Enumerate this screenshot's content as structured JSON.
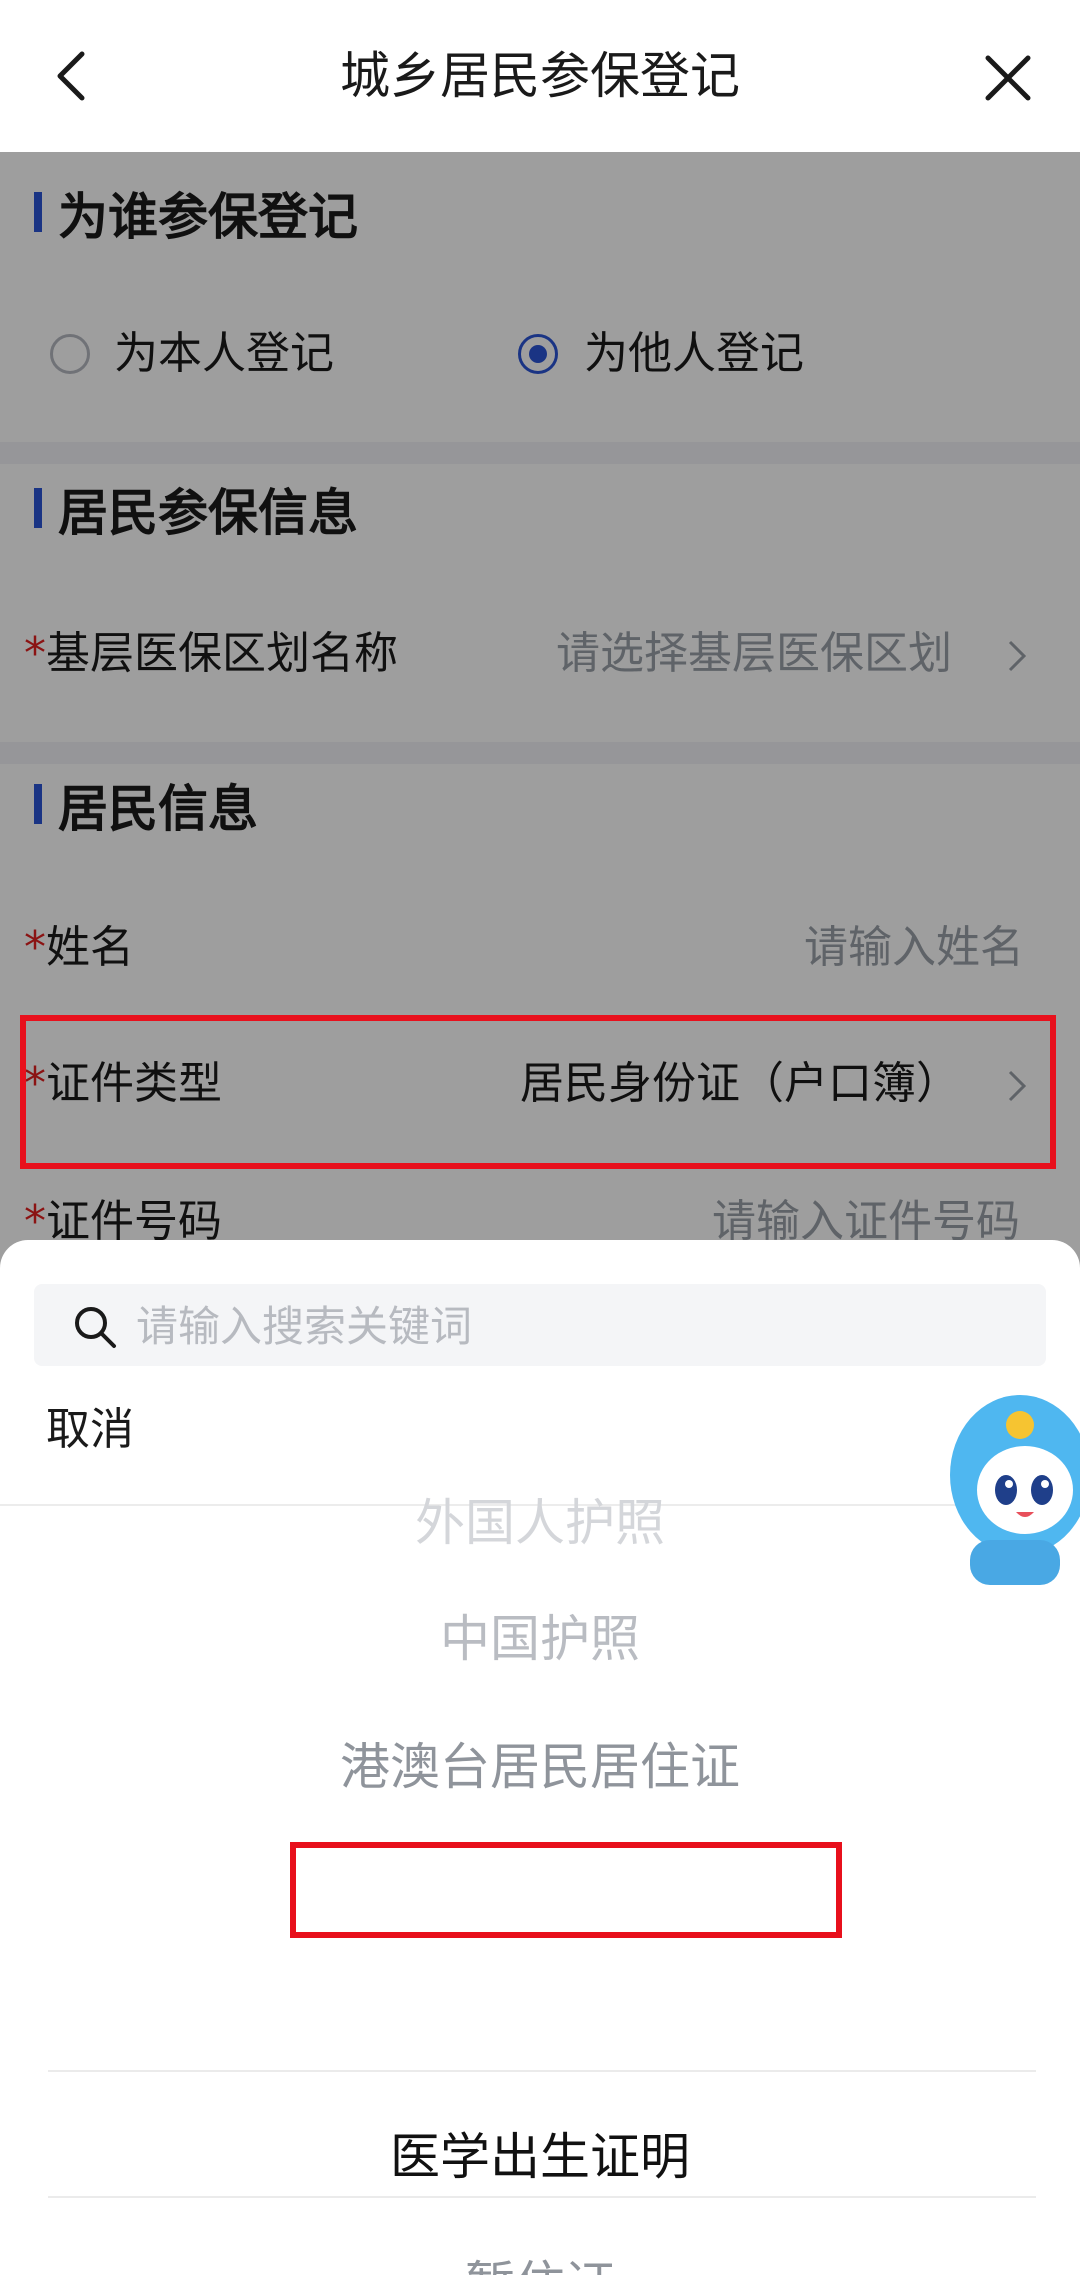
{
  "header": {
    "title": "城乡居民参保登记"
  },
  "section_who": {
    "title": "为谁参保登记",
    "option_self": "为本人登记",
    "option_other": "为他人登记",
    "selected": "为他人登记"
  },
  "section_insurance": {
    "title": "居民参保信息",
    "field_region_label": "基层医保区划名称",
    "field_region_placeholder": "请选择基层医保区划"
  },
  "section_resident": {
    "title": "居民信息",
    "name_label": "姓名",
    "name_placeholder": "请输入姓名",
    "id_type_label": "证件类型",
    "id_type_value": "居民身份证（户口簿）",
    "id_number_label": "证件号码",
    "id_number_placeholder": "请输入证件号码",
    "required_mark": "*"
  },
  "sheet": {
    "search_placeholder": "请输入搜索关键词",
    "cancel_label": "取消",
    "options": [
      "外国人护照",
      "中国护照",
      "港澳台居民居住证",
      "医学出生证明",
      "暂住证"
    ],
    "selected_option": "医学出生证明"
  },
  "colors": {
    "accent": "#2b55d6",
    "highlight": "#e8101c",
    "required": "#e02020"
  }
}
